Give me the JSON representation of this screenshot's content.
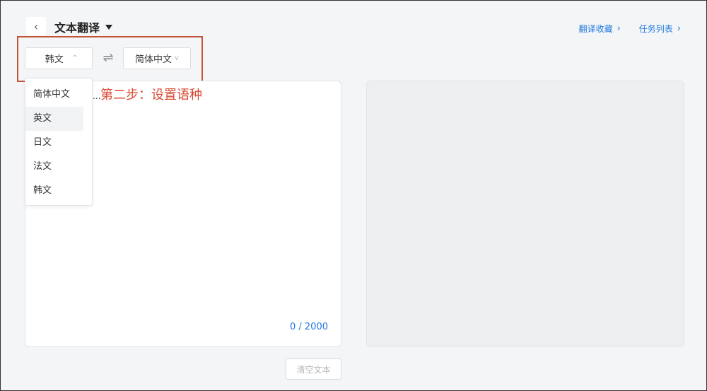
{
  "header": {
    "title": "文本翻译",
    "links": [
      {
        "label": "翻译收藏",
        "chevron": "›"
      },
      {
        "label": "任务列表",
        "chevron": "›"
      }
    ],
    "back_glyph": "‹"
  },
  "lang_bar": {
    "source_lang": "韩文",
    "source_arrow": "^",
    "target_lang": "简体中文",
    "target_arrow": "v",
    "swap_glyph": "⇌"
  },
  "dropdown": {
    "items": [
      "简体中文",
      "英文",
      "日文",
      "法文",
      "韩文"
    ],
    "hovered_index": 1
  },
  "editor": {
    "ellipsis": "...",
    "char_count": "0 / 2000"
  },
  "annotation": "第二步：设置语种",
  "footer": {
    "clear_label": "清空文本"
  },
  "colors": {
    "accent": "#1f7ae0",
    "annotation": "#d84a33",
    "highlight_border": "#c0553a"
  }
}
